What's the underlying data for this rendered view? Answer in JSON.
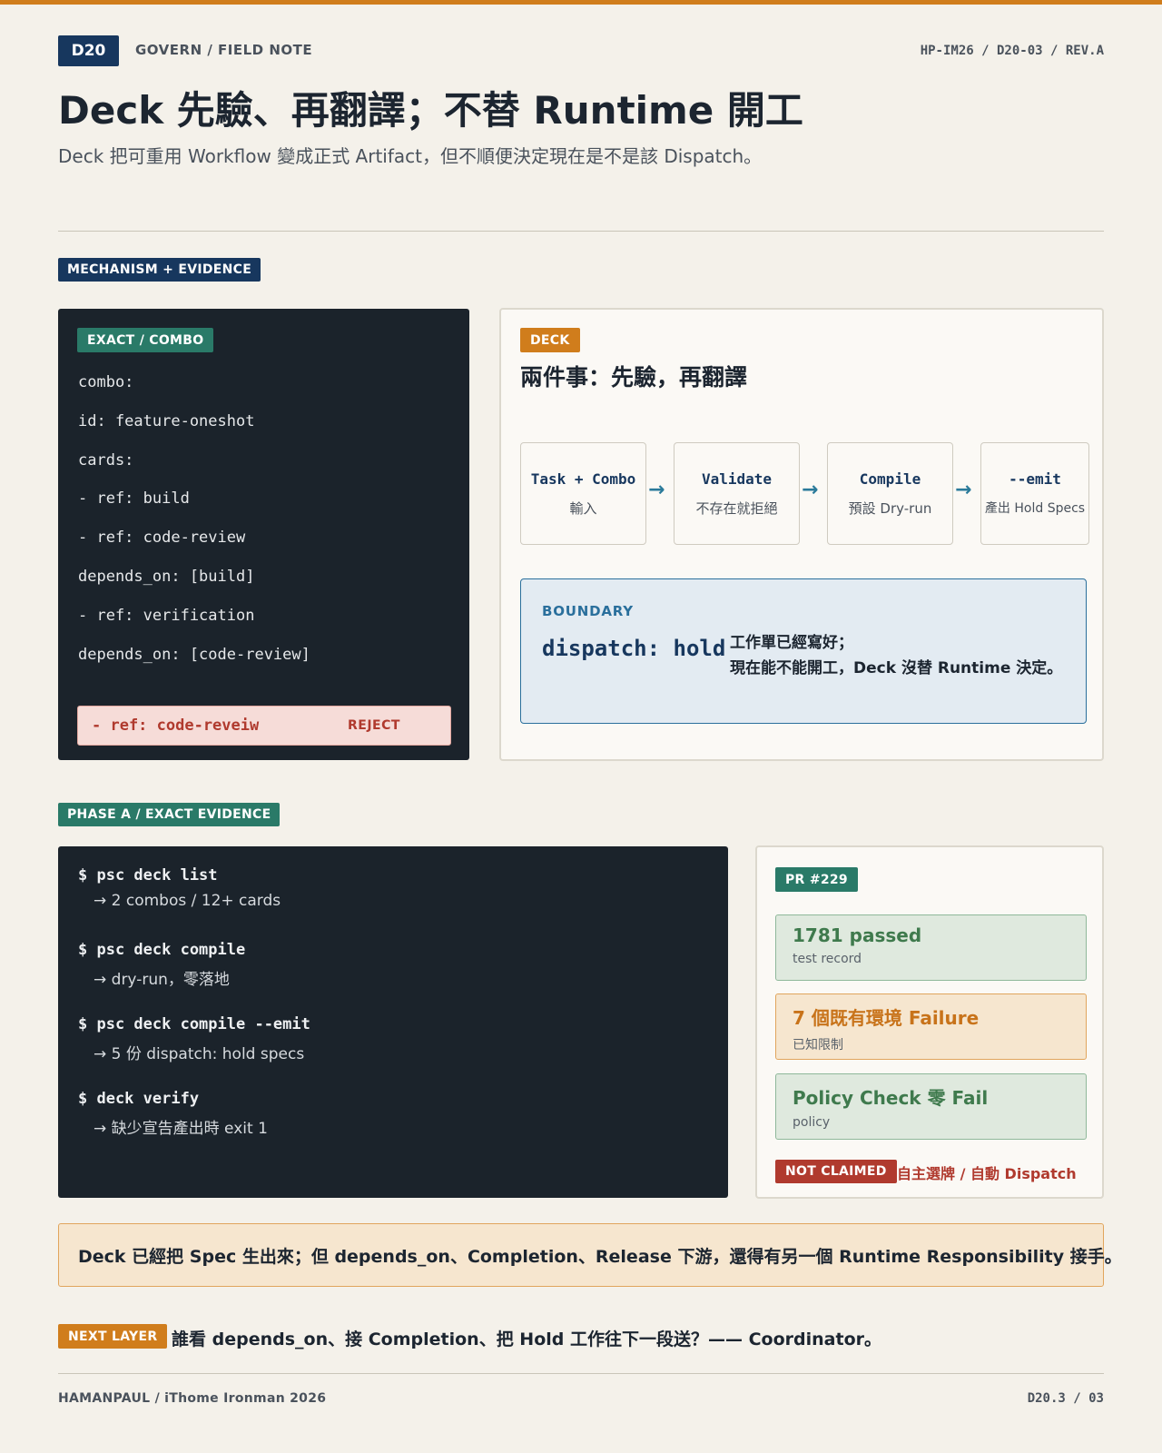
{
  "header": {
    "badge": "D20",
    "section": "GOVERN / FIELD NOTE",
    "doc_id": "HP-IM26 / D20-03 / REV.A",
    "title": "Deck 先驗、再翻譯；不替 Runtime 開工",
    "subtitle": "Deck 把可重用 Workflow 變成正式 Artifact，但不順便決定現在是不是該 Dispatch。"
  },
  "mechanism": {
    "section_tag": "MECHANISM + EVIDENCE",
    "code_panel": {
      "tag": "EXACT / COMBO",
      "lines": [
        "combo:",
        "id: feature-oneshot",
        "cards:",
        "- ref: build",
        "- ref: code-review",
        "depends_on: [build]",
        "- ref: verification",
        "depends_on: [code-review]"
      ],
      "reject_code": "- ref: code-reveiw",
      "reject_label": "REJECT"
    },
    "deck_panel": {
      "tag": "DECK",
      "title": "兩件事：先驗，再翻譯",
      "flow": [
        {
          "name": "Task + Combo",
          "sub": "輸入"
        },
        {
          "name": "Validate",
          "sub": "不存在就拒絕"
        },
        {
          "name": "Compile",
          "sub": "預設 Dry-run"
        },
        {
          "name": "--emit",
          "sub": "產出 Hold Specs"
        }
      ],
      "boundary": {
        "label": "BOUNDARY",
        "code": "dispatch: hold",
        "line1": "工作單已經寫好；",
        "line2": "現在能不能開工，Deck 沒替 Runtime 決定。"
      }
    }
  },
  "phase_a": {
    "section_tag": "PHASE A / EXACT EVIDENCE",
    "terminal": [
      {
        "cmd": "$ psc deck list",
        "out": "→ 2 combos / 12+ cards"
      },
      {
        "cmd": "$ psc deck compile",
        "out": "→ dry-run，零落地"
      },
      {
        "cmd": "$ psc deck compile --emit",
        "out": "→ 5 份 dispatch: hold specs"
      },
      {
        "cmd": "$ deck verify",
        "out": "→ 缺少宣告產出時 exit 1"
      }
    ],
    "pr": {
      "tag": "PR #229",
      "cards": [
        {
          "title": "1781 passed",
          "sub": "test record"
        },
        {
          "title": "7 個既有環境 Failure",
          "sub": "已知限制"
        },
        {
          "title": "Policy Check 零 Fail",
          "sub": "policy"
        }
      ],
      "not_claimed_tag": "NOT CLAIMED",
      "not_claimed_text": "自主選牌 / 自動 Dispatch"
    }
  },
  "summary": "Deck 已經把 Spec 生出來；但 depends_on、Completion、Release 下游，還得有另一個 Runtime Responsibility 接手。",
  "next_layer": {
    "tag": "NEXT LAYER",
    "text": "誰看 depends_on、接 Completion、把 Hold 工作往下一段送？—— Coordinator。"
  },
  "footer": {
    "left": "HAMANPAUL / iThome Ironman 2026",
    "right": "D20.3 / 03"
  }
}
